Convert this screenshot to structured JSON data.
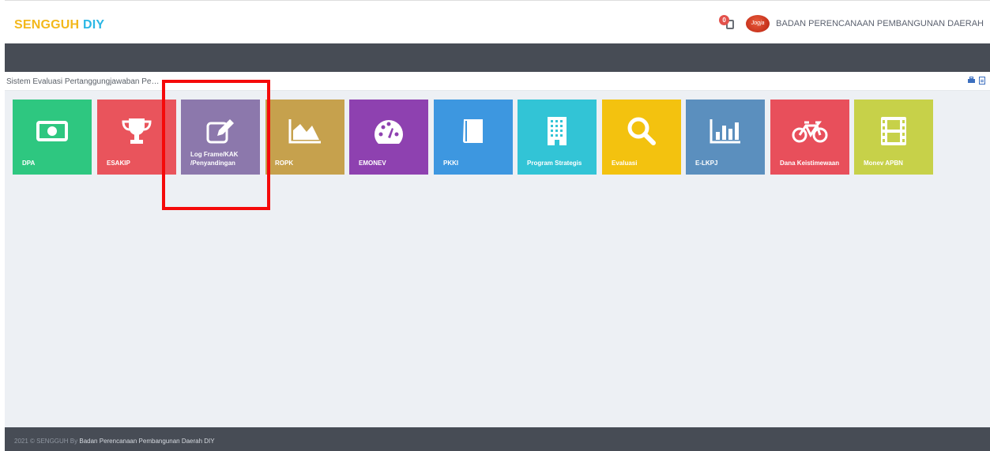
{
  "header": {
    "brand_part1": "SENGGUH",
    "brand_part2": "DIY",
    "notification_count": "0",
    "avatar_text": "Jogja",
    "org_name": "BADAN PERENCANAAN PEMBANGUNAN DAERAH"
  },
  "breadcrumb": {
    "text": "Sistem Evaluasi Pertanggungjawaban Pe…"
  },
  "tiles": [
    {
      "name": "dpa",
      "label": "DPA",
      "color": "#2ec780",
      "icon": "money-bill-icon"
    },
    {
      "name": "esakip",
      "label": "ESAKIP",
      "color": "#e9545c",
      "icon": "trophy-icon"
    },
    {
      "name": "log-frame",
      "label": "Log Frame/KAK /Penyandingan",
      "color": "#8c78ac",
      "icon": "edit-icon"
    },
    {
      "name": "ropk",
      "label": "ROPK",
      "color": "#c6a14d",
      "icon": "area-chart-icon"
    },
    {
      "name": "emonev",
      "label": "EMONEV",
      "color": "#8e41b0",
      "icon": "dashboard-icon"
    },
    {
      "name": "pkki",
      "label": "PKKI",
      "color": "#3d97e0",
      "icon": "book-icon"
    },
    {
      "name": "program-strategis",
      "label": "Program Strategis",
      "color": "#32c4d6",
      "icon": "building-icon"
    },
    {
      "name": "evaluasi",
      "label": "Evaluasi",
      "color": "#f3c20f",
      "icon": "search-icon"
    },
    {
      "name": "e-lkpj",
      "label": "E-LKPJ",
      "color": "#5b8fbe",
      "icon": "bar-chart-icon"
    },
    {
      "name": "dana-keistimewaan",
      "label": "Dana Keistimewaan",
      "color": "#e84f5b",
      "icon": "bicycle-icon"
    },
    {
      "name": "monev-apbn",
      "label": "Monev APBN",
      "color": "#c7d149",
      "icon": "film-icon"
    }
  ],
  "footer": {
    "prefix": "2021 © SENGGUH By ",
    "org": "Badan Perencanaan Pembangunan Daerah DIY"
  }
}
